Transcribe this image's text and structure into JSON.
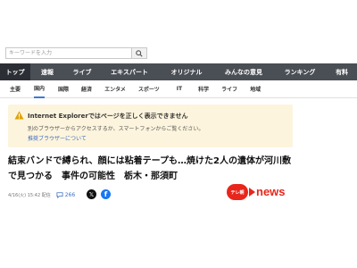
{
  "search": {
    "placeholder": "キーワードを入力"
  },
  "nav": {
    "items": [
      {
        "label": "トップ",
        "active": true
      },
      {
        "label": "速報",
        "active": false
      },
      {
        "label": "ライブ",
        "active": false
      },
      {
        "label": "エキスパート",
        "active": false
      },
      {
        "label": "オリジナル",
        "active": false
      },
      {
        "label": "みんなの意見",
        "active": false
      },
      {
        "label": "ランキング",
        "active": false
      },
      {
        "label": "有料",
        "active": false
      }
    ]
  },
  "subnav": {
    "items": [
      {
        "label": "主要",
        "active": false
      },
      {
        "label": "国内",
        "active": true
      },
      {
        "label": "国際",
        "active": false
      },
      {
        "label": "経済",
        "active": false
      },
      {
        "label": "エンタメ",
        "active": false
      },
      {
        "label": "スポーツ",
        "active": false
      },
      {
        "label": "IT",
        "active": false
      },
      {
        "label": "科学",
        "active": false
      },
      {
        "label": "ライフ",
        "active": false
      },
      {
        "label": "地域",
        "active": false
      }
    ]
  },
  "notice": {
    "title": "Internet Explorerではページを正しく表示できません",
    "text": "別のブラウザーからアクセスするか、スマートフォンからご覧ください。",
    "link": "推奨ブラウザーについて"
  },
  "article": {
    "headline": "結束バンドで縛られ、顔には粘着テープも…焼けた2人の遺体が河川敷で見つかる　事件の可能性　栃木・那須町",
    "date": "4/16(火) 15:42 配信",
    "comments": "266",
    "source_logo_badge": "テレ朝",
    "source_logo_text": "news"
  },
  "colors": {
    "nav_bg": "#4a4e55",
    "nav_active": "#2b2f35",
    "notice_bg": "#fdf4dd",
    "link": "#3d6fc0",
    "brand_red": "#e8261b",
    "facebook": "#1877f2"
  },
  "icons": {
    "search": "search-icon",
    "warning": "warning-icon",
    "comment": "comment-icon",
    "x": "x-share-icon",
    "facebook": "facebook-share-icon"
  }
}
